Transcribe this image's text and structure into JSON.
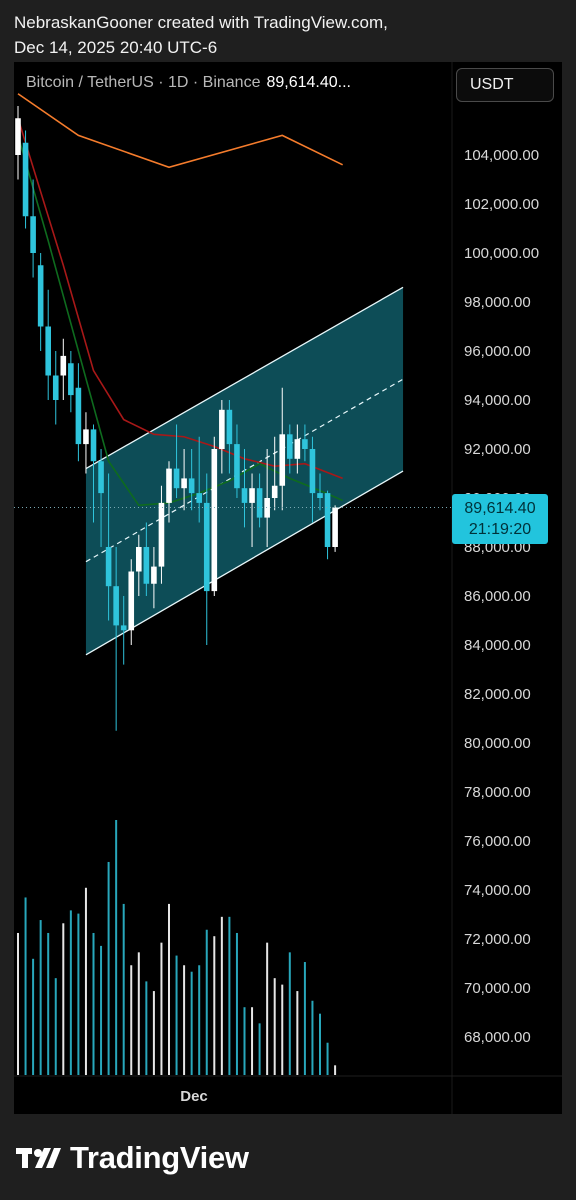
{
  "caption": {
    "line1": "NebraskanGooner created with TradingView.com,",
    "line2": "Dec 14, 2025 20:40 UTC-6"
  },
  "header": {
    "symbol": "Bitcoin / TetherUS · 1D · Binance",
    "price": "89,614.40...",
    "currency_button": "USDT"
  },
  "price_label": {
    "value": "89,614.40",
    "countdown": "21:19:20"
  },
  "footer": {
    "brand": "TradingView"
  },
  "colors": {
    "up": "#ffffff",
    "down": "#2fc4dc",
    "channel_fill": "#0f5a66",
    "ma_orange": "#f57c2c",
    "ma_red": "#a81818",
    "ma_green": "#0e6b1e",
    "price_label_bg": "#22c4dd"
  },
  "chart_data": {
    "type": "candlestick",
    "title": "",
    "xlabel": "",
    "ylabel": "",
    "y_tick_labels": [
      "104,000.00",
      "102,000.00",
      "100,000.00",
      "98,000.00",
      "96,000.00",
      "94,000.00",
      "92,000.00",
      "90,000.00",
      "88,000.00",
      "86,000.00",
      "84,000.00",
      "82,000.00",
      "80,000.00",
      "78,000.00",
      "76,000.00",
      "74,000.00",
      "72,000.00",
      "70,000.00",
      "68,000.00"
    ],
    "x_tick_labels": [
      "Dec"
    ],
    "ylim": [
      66400,
      106000
    ],
    "last_price": 89614.4,
    "candles": [
      {
        "o": 104000,
        "h": 106000,
        "l": 103000,
        "c": 105500
      },
      {
        "o": 104500,
        "h": 105000,
        "l": 101000,
        "c": 101500
      },
      {
        "o": 101500,
        "h": 103000,
        "l": 99000,
        "c": 100000
      },
      {
        "o": 99500,
        "h": 100000,
        "l": 96000,
        "c": 97000
      },
      {
        "o": 97000,
        "h": 98500,
        "l": 94000,
        "c": 95000
      },
      {
        "o": 95000,
        "h": 96000,
        "l": 93000,
        "c": 94000
      },
      {
        "o": 95000,
        "h": 96500,
        "l": 94000,
        "c": 95800
      },
      {
        "o": 95500,
        "h": 96000,
        "l": 93500,
        "c": 94200
      },
      {
        "o": 94500,
        "h": 95500,
        "l": 91500,
        "c": 92200
      },
      {
        "o": 92200,
        "h": 93500,
        "l": 91000,
        "c": 92800
      },
      {
        "o": 92800,
        "h": 93000,
        "l": 89000,
        "c": 91500
      },
      {
        "o": 91500,
        "h": 92000,
        "l": 88000,
        "c": 90200
      },
      {
        "o": 88000,
        "h": 91000,
        "l": 85000,
        "c": 86400
      },
      {
        "o": 86400,
        "h": 88000,
        "l": 80500,
        "c": 84800
      },
      {
        "o": 84800,
        "h": 86000,
        "l": 83200,
        "c": 84600
      },
      {
        "o": 84600,
        "h": 87500,
        "l": 84000,
        "c": 87000
      },
      {
        "o": 87000,
        "h": 88500,
        "l": 86000,
        "c": 88000
      },
      {
        "o": 88000,
        "h": 89000,
        "l": 86000,
        "c": 86500
      },
      {
        "o": 86500,
        "h": 88000,
        "l": 85500,
        "c": 87200
      },
      {
        "o": 87200,
        "h": 90500,
        "l": 86500,
        "c": 89800
      },
      {
        "o": 89800,
        "h": 91500,
        "l": 89000,
        "c": 91200
      },
      {
        "o": 91200,
        "h": 93000,
        "l": 90000,
        "c": 90400
      },
      {
        "o": 90400,
        "h": 92000,
        "l": 89500,
        "c": 90800
      },
      {
        "o": 90800,
        "h": 92000,
        "l": 89500,
        "c": 90200
      },
      {
        "o": 90200,
        "h": 92500,
        "l": 89000,
        "c": 89800
      },
      {
        "o": 89800,
        "h": 91000,
        "l": 84000,
        "c": 86200
      },
      {
        "o": 86200,
        "h": 92500,
        "l": 86000,
        "c": 92000
      },
      {
        "o": 92000,
        "h": 94000,
        "l": 91000,
        "c": 93600
      },
      {
        "o": 93600,
        "h": 94000,
        "l": 91000,
        "c": 92200
      },
      {
        "o": 92200,
        "h": 93000,
        "l": 90000,
        "c": 90400
      },
      {
        "o": 90400,
        "h": 92000,
        "l": 88800,
        "c": 89800
      },
      {
        "o": 89800,
        "h": 91000,
        "l": 88000,
        "c": 90400
      },
      {
        "o": 90400,
        "h": 91000,
        "l": 88800,
        "c": 89200
      },
      {
        "o": 89200,
        "h": 92000,
        "l": 88000,
        "c": 90000
      },
      {
        "o": 90000,
        "h": 92500,
        "l": 89500,
        "c": 90500
      },
      {
        "o": 90500,
        "h": 94500,
        "l": 89500,
        "c": 92600
      },
      {
        "o": 92600,
        "h": 93000,
        "l": 91000,
        "c": 91600
      },
      {
        "o": 91600,
        "h": 93000,
        "l": 91000,
        "c": 92400
      },
      {
        "o": 92400,
        "h": 93000,
        "l": 91500,
        "c": 92000
      },
      {
        "o": 92000,
        "h": 92500,
        "l": 89000,
        "c": 90200
      },
      {
        "o": 90200,
        "h": 91000,
        "l": 89500,
        "c": 90000
      },
      {
        "o": 90200,
        "h": 90300,
        "l": 87500,
        "c": 88000
      },
      {
        "o": 88000,
        "h": 89700,
        "l": 87800,
        "c": 89614.4
      }
    ],
    "volume": [
      44,
      55,
      36,
      48,
      44,
      30,
      47,
      51,
      50,
      58,
      44,
      40,
      66,
      79,
      53,
      34,
      38,
      29,
      26,
      41,
      53,
      37,
      34,
      32,
      34,
      45,
      43,
      49,
      49,
      44,
      21,
      21,
      16,
      41,
      30,
      28,
      38,
      26,
      35,
      23,
      19,
      10,
      3
    ],
    "moving_averages": [
      {
        "color": "orange",
        "points": [
          [
            0,
            106500
          ],
          [
            8,
            104800
          ],
          [
            20,
            103500
          ],
          [
            35,
            104800
          ],
          [
            43,
            103600
          ]
        ]
      },
      {
        "color": "red",
        "points": [
          [
            0,
            105500
          ],
          [
            6,
            99500
          ],
          [
            10,
            95200
          ],
          [
            14,
            93200
          ],
          [
            18,
            92600
          ],
          [
            22,
            92500
          ],
          [
            26,
            92100
          ],
          [
            30,
            91600
          ],
          [
            34,
            91300
          ],
          [
            38,
            91400
          ],
          [
            43,
            90800
          ]
        ]
      },
      {
        "color": "green",
        "points": [
          [
            0,
            104800
          ],
          [
            4,
            100500
          ],
          [
            8,
            96000
          ],
          [
            12,
            91500
          ],
          [
            16,
            89700
          ],
          [
            20,
            89800
          ],
          [
            24,
            90200
          ],
          [
            28,
            90700
          ],
          [
            32,
            91400
          ],
          [
            36,
            90800
          ],
          [
            40,
            90300
          ],
          [
            43,
            89900
          ]
        ]
      }
    ],
    "channel": {
      "lower": [
        [
          9,
          83600
        ],
        [
          51,
          91100
        ]
      ],
      "upper": [
        [
          9,
          91200
        ],
        [
          51,
          98600
        ]
      ],
      "mid_dashed": true
    }
  }
}
